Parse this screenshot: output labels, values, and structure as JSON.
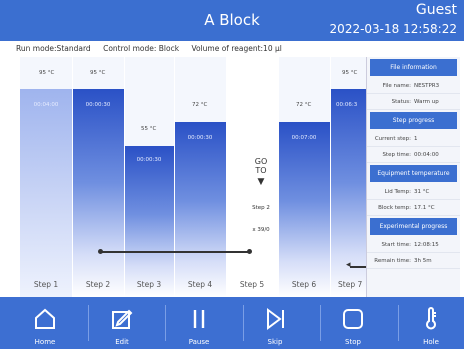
{
  "header": {
    "title": "A Block",
    "user": "Guest",
    "datetime": "2022-03-18 12:58:22"
  },
  "info": {
    "run_mode": "Run mode:Standard",
    "control_mode": "Control mode: Block",
    "volume": "Volume of reagent:10 μl"
  },
  "steps": [
    {
      "label": "Step 1",
      "temp": "95 °C",
      "time": "00:04:00",
      "level": 0.88,
      "selected": true
    },
    {
      "label": "Step 2",
      "temp": "95 °C",
      "time": "00:00:30",
      "level": 0.88
    },
    {
      "label": "Step 3",
      "temp": "55 °C",
      "time": "00:00:30",
      "level": 0.62
    },
    {
      "label": "Step 4",
      "temp": "72 °C",
      "time": "00:00:30",
      "level": 0.73
    },
    {
      "label": "Step 5"
    },
    {
      "label": "Step 6",
      "temp": "72 °C",
      "time": "00:07:00",
      "level": 0.73
    },
    {
      "label": "Step 7",
      "temp": "95 °C",
      "time": "00:06:3",
      "level": 0.88
    }
  ],
  "goto": {
    "line1": "GO",
    "line2": "TO",
    "arrow": "▼",
    "step": "Step 2",
    "repeat": "x 39/0"
  },
  "side": {
    "file_header": "File information",
    "file_name_k": "File name:",
    "file_name_v": "NESTPR3",
    "status_k": "Status:",
    "status_v": "Warm up",
    "step_header": "Step progress",
    "current_step_k": "Current step:",
    "current_step_v": "1",
    "step_time_k": "Step time:",
    "step_time_v": "00:04:00",
    "equip_header": "Equipment temperature",
    "lid_k": "Lid Temp:",
    "lid_v": "31 °C",
    "block_k": "Block temp:",
    "block_v": "17.1 °C",
    "exp_header": "Experimental progress",
    "start_k": "Start time:",
    "start_v": "12:08:15",
    "remain_k": "Remain time:",
    "remain_v": "3h 5m"
  },
  "nav": {
    "home": "Home",
    "edit": "Edit",
    "pause": "Pause",
    "skip": "Skip",
    "stop": "Stop",
    "hole": "Hole"
  }
}
